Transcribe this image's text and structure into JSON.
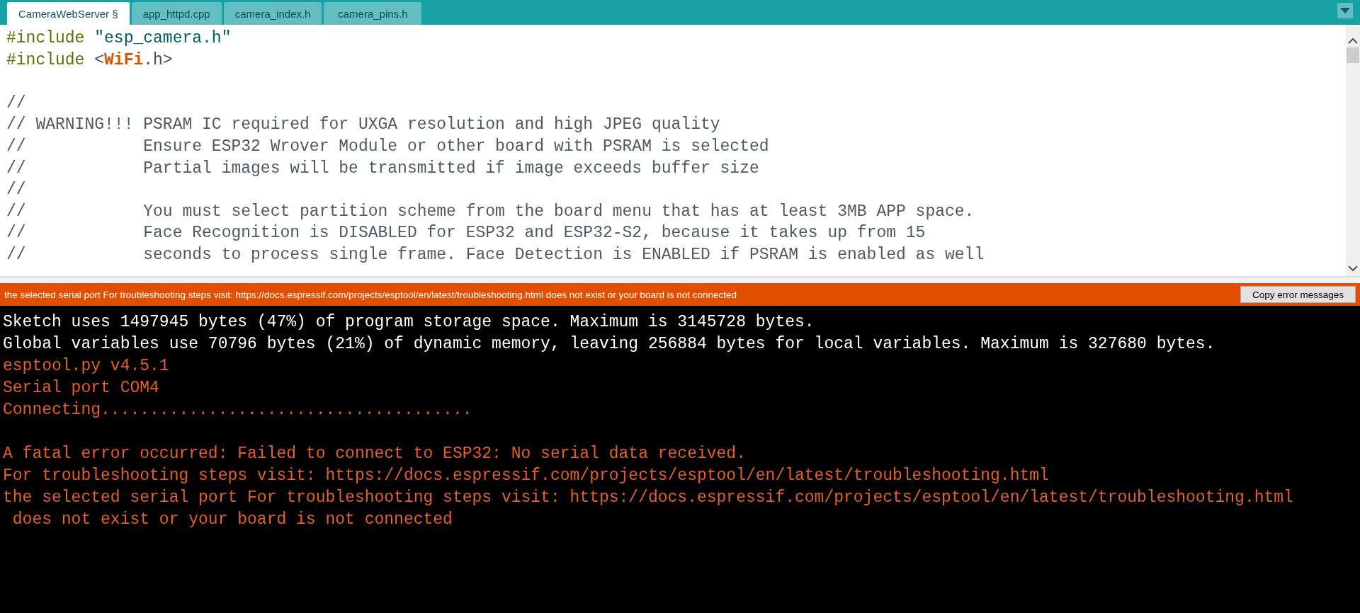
{
  "tabs": [
    {
      "label": "CameraWebServer §",
      "selected": true
    },
    {
      "label": "app_httpd.cpp",
      "selected": false
    },
    {
      "label": "camera_index.h",
      "selected": false
    },
    {
      "label": "camera_pins.h",
      "selected": false
    }
  ],
  "editor": {
    "lines": [
      {
        "kind": "code",
        "segments": [
          {
            "kind": "directive",
            "text": "#include "
          },
          {
            "kind": "string",
            "text": "\"esp_camera.h\""
          }
        ]
      },
      {
        "kind": "code",
        "segments": [
          {
            "kind": "directive",
            "text": "#include "
          },
          {
            "kind": "plain",
            "text": "<"
          },
          {
            "kind": "type",
            "text": "WiFi"
          },
          {
            "kind": "plain",
            "text": ".h>"
          }
        ]
      },
      {
        "kind": "blank"
      },
      {
        "kind": "code",
        "segments": [
          {
            "kind": "comment",
            "text": "//"
          }
        ]
      },
      {
        "kind": "code",
        "segments": [
          {
            "kind": "comment",
            "text": "// WARNING!!! PSRAM IC required for UXGA resolution and high JPEG quality"
          }
        ]
      },
      {
        "kind": "code",
        "segments": [
          {
            "kind": "comment",
            "text": "//            Ensure ESP32 Wrover Module or other board with PSRAM is selected"
          }
        ]
      },
      {
        "kind": "code",
        "segments": [
          {
            "kind": "comment",
            "text": "//            Partial images will be transmitted if image exceeds buffer size"
          }
        ]
      },
      {
        "kind": "code",
        "segments": [
          {
            "kind": "comment",
            "text": "//"
          }
        ]
      },
      {
        "kind": "code",
        "segments": [
          {
            "kind": "comment",
            "text": "//            You must select partition scheme from the board menu that has at least 3MB APP space."
          }
        ]
      },
      {
        "kind": "code",
        "segments": [
          {
            "kind": "comment",
            "text": "//            Face Recognition is DISABLED for ESP32 and ESP32-S2, because it takes up from 15"
          }
        ]
      },
      {
        "kind": "code",
        "segments": [
          {
            "kind": "comment",
            "text": "//            seconds to process single frame. Face Detection is ENABLED if PSRAM is enabled as well"
          }
        ]
      }
    ]
  },
  "error_bar": {
    "message": "the selected serial port For troubleshooting steps visit: https://docs.espressif.com/projects/esptool/en/latest/troubleshooting.html does not exist or your board is not connected",
    "button": "Copy error messages"
  },
  "console": {
    "lines": [
      {
        "kind": "output",
        "text": "Sketch uses 1497945 bytes (47%) of program storage space. Maximum is 3145728 bytes."
      },
      {
        "kind": "output",
        "text": "Global variables use 70796 bytes (21%) of dynamic memory, leaving 256884 bytes for local variables. Maximum is 327680 bytes."
      },
      {
        "kind": "error",
        "text": "esptool.py v4.5.1"
      },
      {
        "kind": "error",
        "text": "Serial port COM4"
      },
      {
        "kind": "error",
        "text": "Connecting......................................"
      },
      {
        "kind": "blank"
      },
      {
        "kind": "error",
        "text": "A fatal error occurred: Failed to connect to ESP32: No serial data received."
      },
      {
        "kind": "error",
        "text": "For troubleshooting steps visit: https://docs.espressif.com/projects/esptool/en/latest/troubleshooting.html"
      },
      {
        "kind": "error",
        "text": "the selected serial port For troubleshooting steps visit: https://docs.espressif.com/projects/esptool/en/latest/troubleshooting.html"
      },
      {
        "kind": "error",
        "text": " does not exist or your board is not connected"
      }
    ]
  }
}
